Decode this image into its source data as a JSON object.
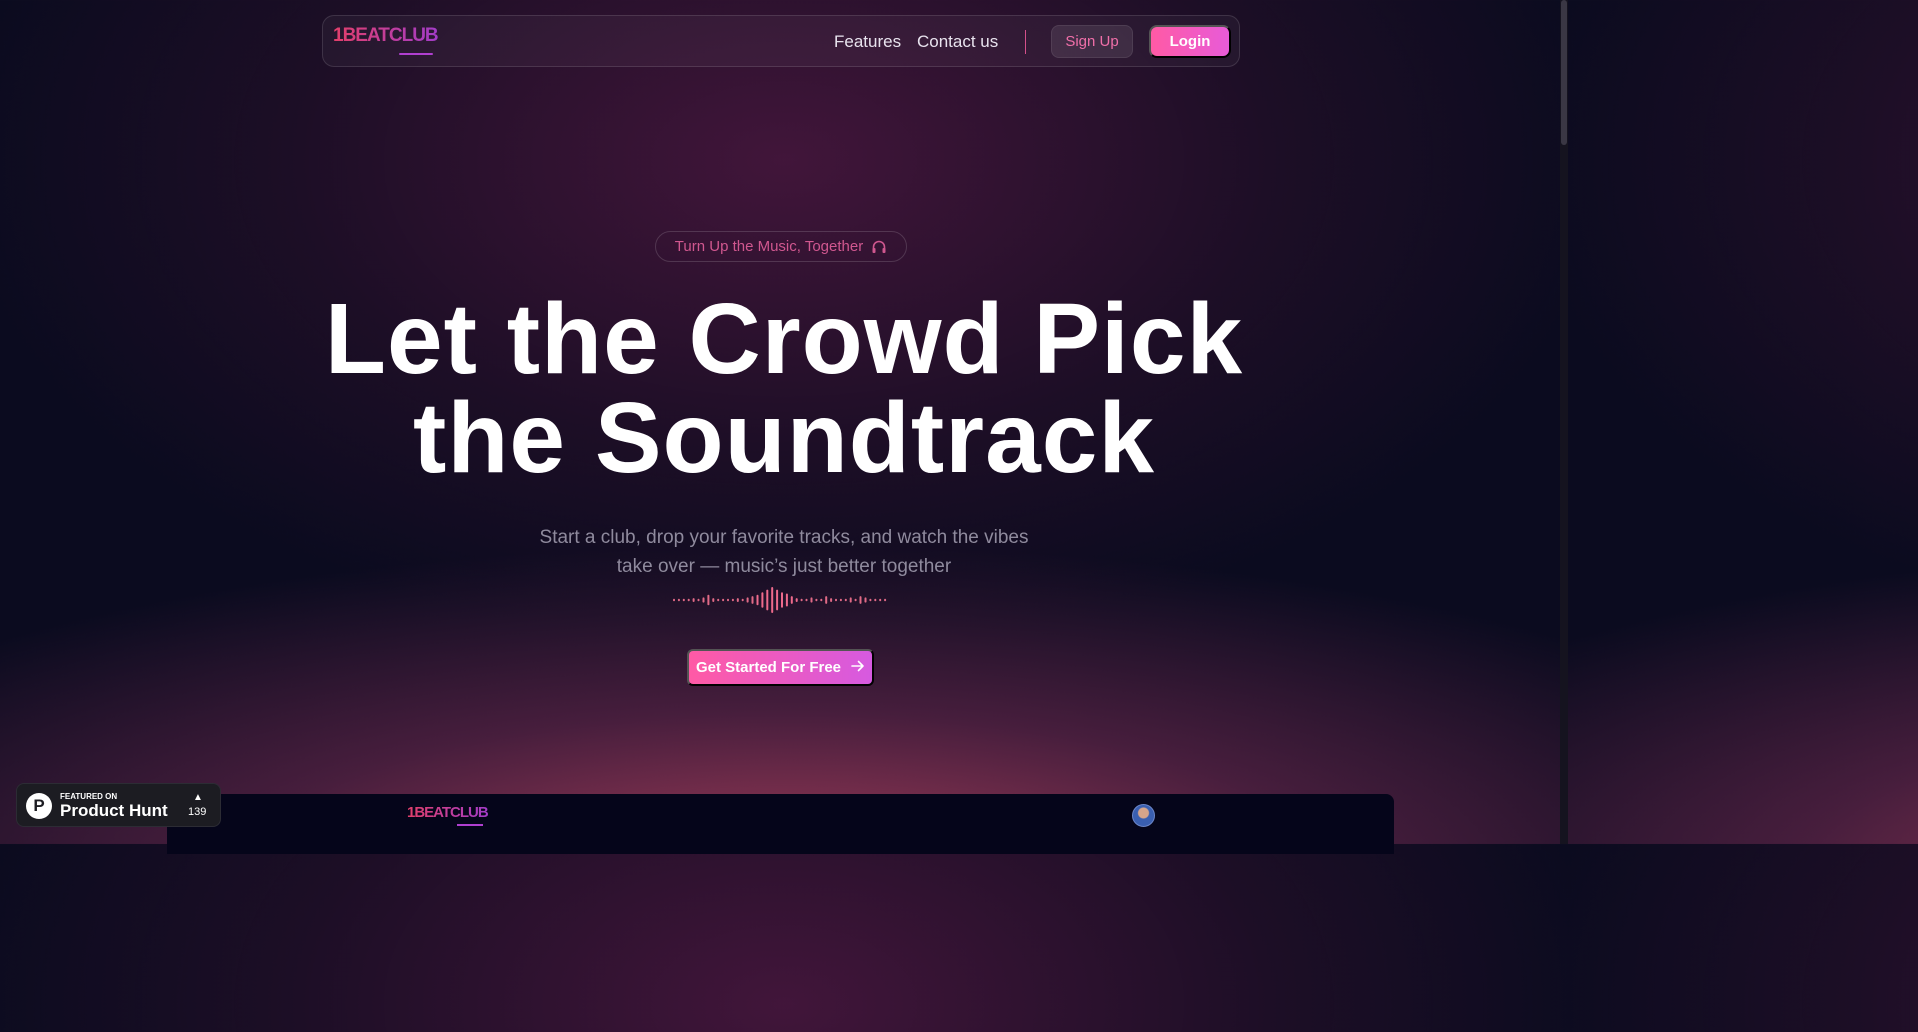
{
  "nav": {
    "logo_text": "1BEATCLUB",
    "links": [
      "Features",
      "Contact us"
    ],
    "signup_label": "Sign Up",
    "login_label": "Login"
  },
  "hero": {
    "tagline": "Turn Up the Music, Together",
    "tagline_icon": "headphones-icon",
    "headline_line1": "Let the Crowd Pick",
    "headline_line2": "the Soundtrack",
    "subtext_line1": "Start a club, drop your favorite tracks, and watch the vibes",
    "subtext_line2": "take over — music’s just better together",
    "cta_label": "Get Started For Free",
    "cta_icon": "arrow-right-icon"
  },
  "preview": {
    "logo_text": "1BEATCLUB",
    "avatar_icon": "user-avatar"
  },
  "product_hunt": {
    "featured_label": "FEATURED ON",
    "name": "Product Hunt",
    "upvote_icon": "upvote-arrow-icon",
    "count": "139"
  },
  "colors": {
    "accent_pink": "#ff5aa5",
    "accent_purple": "#a33cc8",
    "background": "#0b0b1f"
  }
}
